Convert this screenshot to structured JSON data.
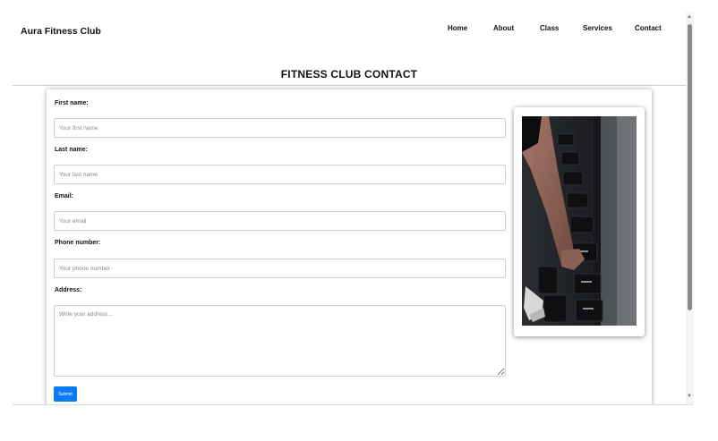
{
  "header": {
    "brand": "Aura Fitness Club",
    "nav": [
      {
        "label": "Home"
      },
      {
        "label": "About"
      },
      {
        "label": "Class"
      },
      {
        "label": "Services"
      },
      {
        "label": "Contact"
      }
    ]
  },
  "page": {
    "title": "FITNESS CLUB CONTACT"
  },
  "form": {
    "first_name": {
      "label": "First name:",
      "placeholder": "Your first name"
    },
    "last_name": {
      "label": "Last name:",
      "placeholder": "Your last name"
    },
    "email": {
      "label": "Email:",
      "placeholder": "Your email"
    },
    "phone": {
      "label": "Phone number:",
      "placeholder": "Your phone number"
    },
    "address": {
      "label": "Address:",
      "placeholder": "Write your address..."
    },
    "submit_label": "Submit"
  },
  "image": {
    "subject": "person lifting dumbbell from rack"
  },
  "colors": {
    "accent": "#0b7bf2",
    "text": "#111111",
    "border": "#cfcfcf"
  },
  "icons": {
    "scroll_up": "scroll-up-arrow-icon",
    "scroll_down": "scroll-down-arrow-icon"
  }
}
